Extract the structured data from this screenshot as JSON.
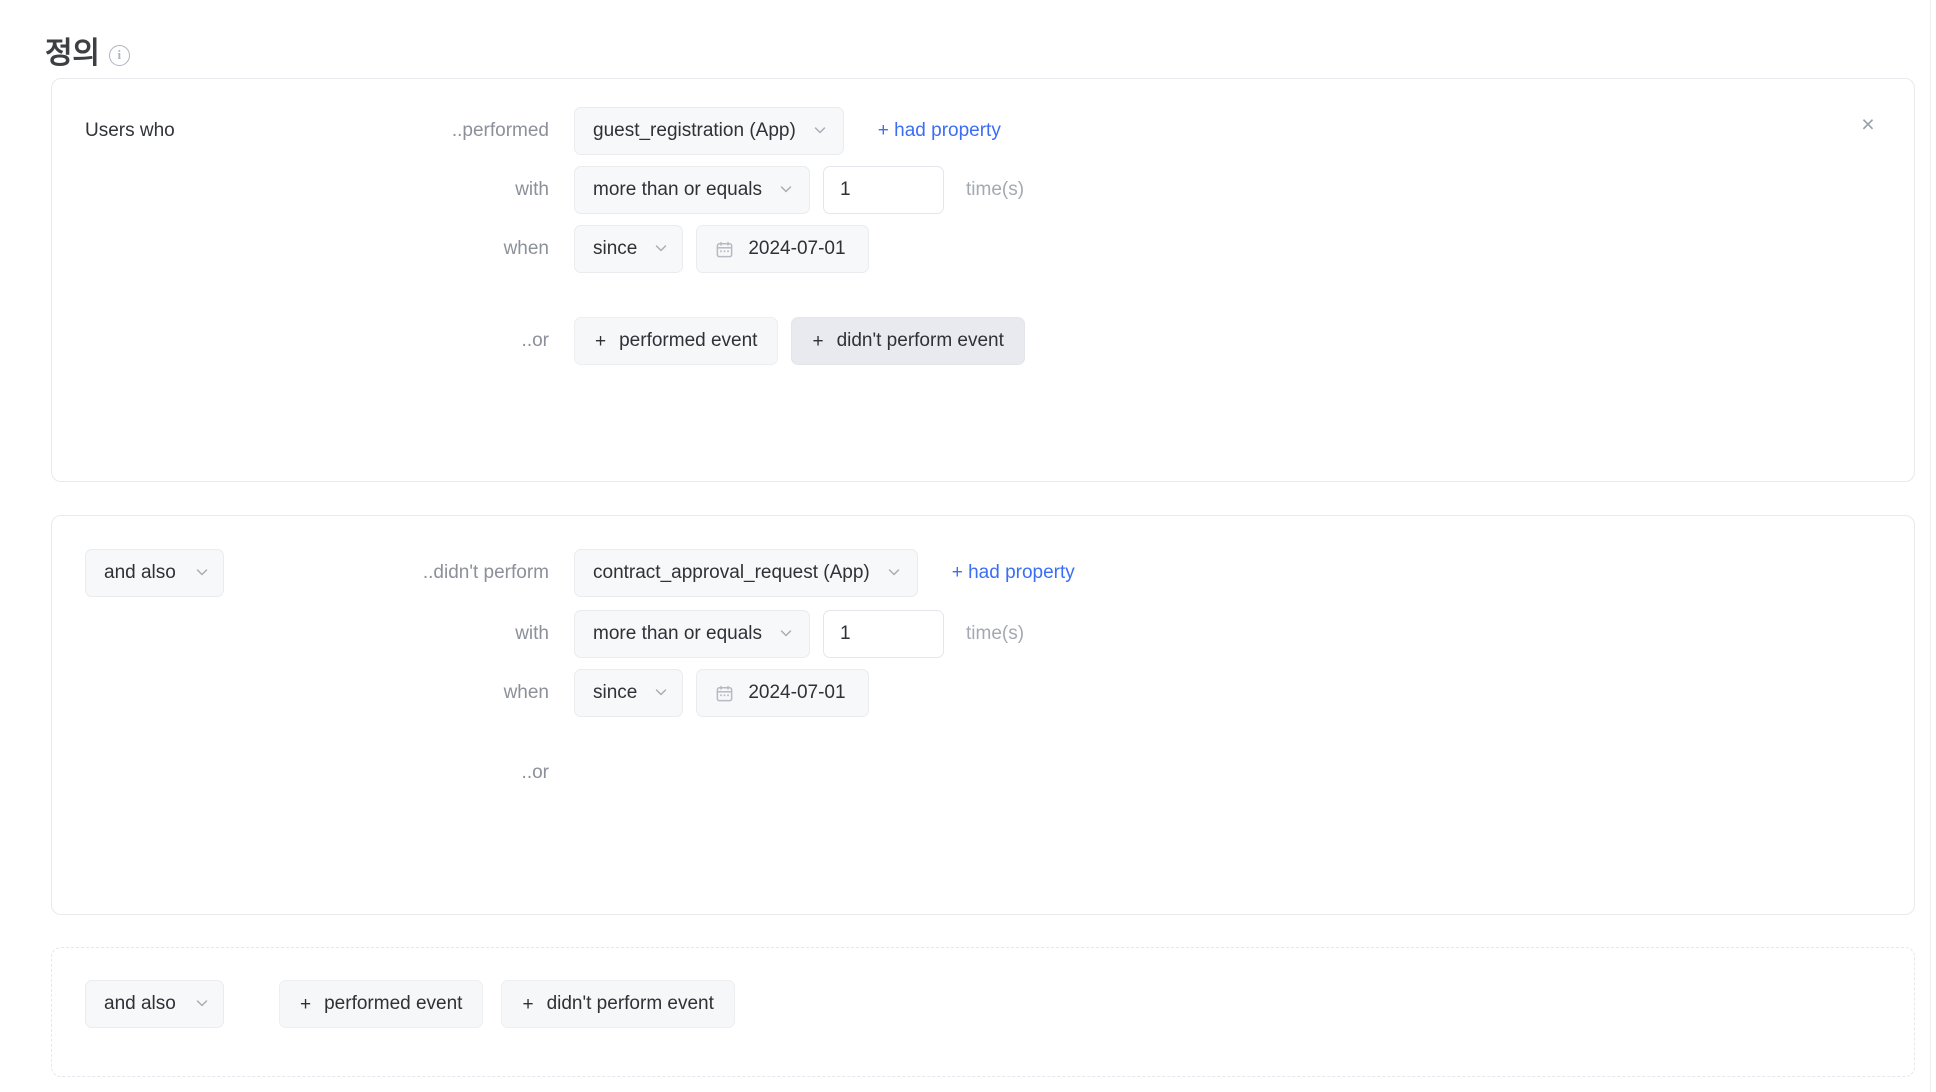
{
  "header": {
    "title": "정의",
    "info_icon": "info-icon",
    "info_glyph": "i"
  },
  "colors": {
    "link": "#3b6ef5",
    "text": "#2e3136",
    "muted": "#8b9099",
    "border": "#e8eaee",
    "field_bg": "#f7f8fa"
  },
  "cards": [
    {
      "id": "card-1",
      "style": "solid",
      "has_close": true,
      "close_label": "×",
      "lead_label": "Users who",
      "rows": {
        "event": {
          "label": "..performed",
          "event_value": "guest_registration (App)",
          "property_link": "+ had property"
        },
        "count": {
          "label": "with",
          "operator": "more than or equals",
          "value": "1",
          "unit": "time(s)"
        },
        "date": {
          "label": "when",
          "range": "since",
          "date_value": "2024-07-01"
        },
        "or": {
          "label": "..or",
          "buttons": [
            {
              "label": "performed event",
              "plus": "+",
              "state": "normal"
            },
            {
              "label": "didn't perform event",
              "plus": "+",
              "state": "hovered"
            }
          ]
        }
      }
    },
    {
      "id": "card-2",
      "style": "solid",
      "has_close": false,
      "conjunction": "and also",
      "rows": {
        "event": {
          "label": "..didn't perform",
          "event_value": "contract_approval_request (App)",
          "property_link": "+ had property"
        },
        "count": {
          "label": "with",
          "operator": "more than or equals",
          "value": "1",
          "unit": "time(s)"
        },
        "date": {
          "label": "when",
          "range": "since",
          "date_value": "2024-07-01"
        },
        "or": {
          "label": "..or",
          "buttons": []
        }
      }
    },
    {
      "id": "card-3",
      "style": "dashed",
      "conjunction": "and also",
      "buttons": [
        {
          "label": "performed event",
          "plus": "+"
        },
        {
          "label": "didn't perform event",
          "plus": "+"
        }
      ]
    }
  ]
}
